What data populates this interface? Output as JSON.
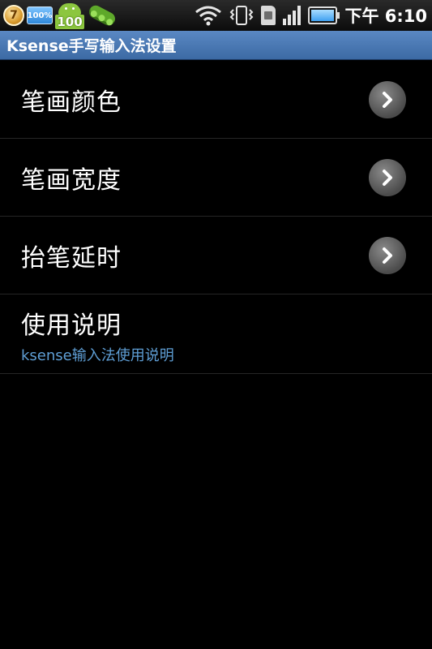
{
  "status_bar": {
    "notifications": [
      {
        "icon": "coin-badge-icon",
        "text": "7"
      },
      {
        "icon": "battery-percent-icon",
        "text": "100%"
      },
      {
        "icon": "android-app-icon",
        "text": "100"
      },
      {
        "icon": "pea-pod-icon"
      }
    ],
    "system_icons": [
      "wifi-icon",
      "vibrate-icon",
      "sim-card-icon",
      "signal-bars-icon",
      "battery-icon"
    ],
    "battery_level": 1.0,
    "time": "下午 6:10"
  },
  "title_bar": {
    "title": "Ksense手写输入法设置"
  },
  "settings": [
    {
      "label": "笔画颜色",
      "icon": "chevron-right-icon"
    },
    {
      "label": "笔画宽度",
      "icon": "chevron-right-icon"
    },
    {
      "label": "抬笔延时",
      "icon": "chevron-right-icon"
    },
    {
      "label": "使用说明",
      "summary": "ksense输入法使用说明"
    }
  ],
  "colors": {
    "background": "#000000",
    "title_bar": "#4a78b4",
    "summary_text": "#5f9fd6",
    "divider": "#262626"
  }
}
